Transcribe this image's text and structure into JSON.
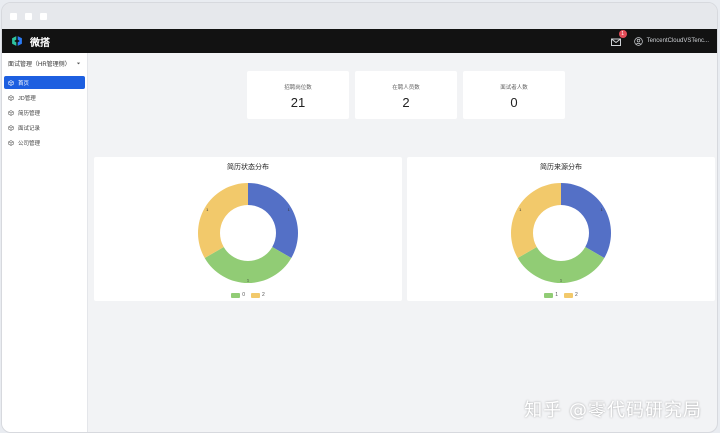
{
  "window": {
    "controls": [
      "min",
      "max",
      "close"
    ]
  },
  "topbar": {
    "brand": "微搭",
    "notification_count": "1",
    "user_name": "TencentCloudVSTenc..."
  },
  "sidebar": {
    "app_select": "面试管理（HR管理侧）",
    "items": [
      {
        "label": "首页",
        "active": true
      },
      {
        "label": "JD管理",
        "active": false
      },
      {
        "label": "简历管理",
        "active": false
      },
      {
        "label": "面试记录",
        "active": false
      },
      {
        "label": "公司管理",
        "active": false
      }
    ]
  },
  "stats": [
    {
      "label": "招聘岗位数",
      "value": "21"
    },
    {
      "label": "在聘人员数",
      "value": "2"
    },
    {
      "label": "面试者人数",
      "value": "0"
    }
  ],
  "chart_data": [
    {
      "type": "pie",
      "title": "简历状态分布",
      "donut": true,
      "slices": [
        {
          "label": "1",
          "value": 1,
          "color": "#5470c6"
        },
        {
          "label": "1",
          "value": 1,
          "color": "#91cc75"
        },
        {
          "label": "1",
          "value": 1,
          "color": "#f2c96b"
        }
      ],
      "legend": [
        {
          "name": "0",
          "color": "#91cc75"
        },
        {
          "name": "2",
          "color": "#f2c96b"
        }
      ],
      "legend_position": "bottom"
    },
    {
      "type": "pie",
      "title": "简历来源分布",
      "donut": true,
      "slices": [
        {
          "label": "1",
          "value": 1,
          "color": "#5470c6"
        },
        {
          "label": "1",
          "value": 1,
          "color": "#91cc75"
        },
        {
          "label": "1",
          "value": 1,
          "color": "#f2c96b"
        }
      ],
      "legend": [
        {
          "name": "1",
          "color": "#91cc75"
        },
        {
          "name": "2",
          "color": "#f2c96b"
        }
      ],
      "legend_position": "bottom"
    }
  ],
  "watermark": "知乎 @零代码研究局"
}
